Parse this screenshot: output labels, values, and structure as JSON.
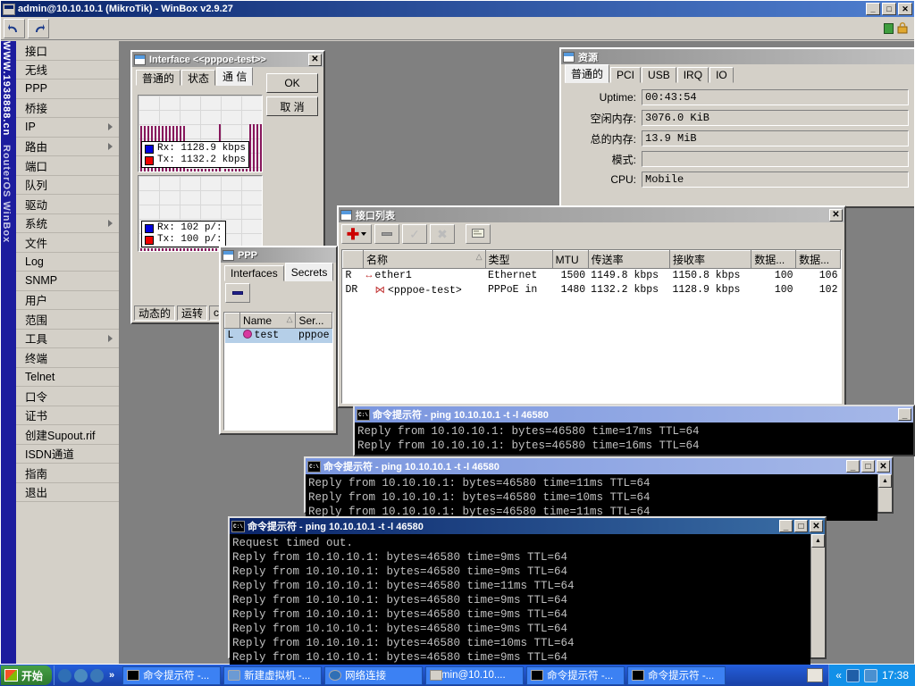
{
  "window": {
    "title": "admin@10.10.10.1 (MikroTik) - WinBox v2.9.27",
    "minimize": "_",
    "restore": "□",
    "close": "✕"
  },
  "toolbar": {
    "undo_icon": "undo-arrow-icon",
    "redo_icon": "redo-arrow-icon",
    "status_icon": "green-bars-icon",
    "lock_icon": "padlock-icon"
  },
  "banner": {
    "url": "WWW.1938888.cn",
    "product": "RouterOS WinBox"
  },
  "menu": {
    "items": [
      {
        "label": "接口",
        "submenu": false
      },
      {
        "label": "无线",
        "submenu": false
      },
      {
        "label": "PPP",
        "submenu": false
      },
      {
        "label": "桥接",
        "submenu": false
      },
      {
        "label": "IP",
        "submenu": true
      },
      {
        "label": "路由",
        "submenu": true
      },
      {
        "label": "端口",
        "submenu": false
      },
      {
        "label": "队列",
        "submenu": false
      },
      {
        "label": "驱动",
        "submenu": false
      },
      {
        "label": "系统",
        "submenu": true
      },
      {
        "label": "文件",
        "submenu": false
      },
      {
        "label": "Log",
        "submenu": false
      },
      {
        "label": "SNMP",
        "submenu": false
      },
      {
        "label": "用户",
        "submenu": false
      },
      {
        "label": "范围",
        "submenu": false
      },
      {
        "label": "工具",
        "submenu": true
      },
      {
        "label": "终端",
        "submenu": false
      },
      {
        "label": "Telnet",
        "submenu": false
      },
      {
        "label": "口令",
        "submenu": false
      },
      {
        "label": "证书",
        "submenu": false
      },
      {
        "label": "创建Supout.rif",
        "submenu": false
      },
      {
        "label": "ISDN通道",
        "submenu": false
      },
      {
        "label": "指南",
        "submenu": false
      },
      {
        "label": "退出",
        "submenu": false
      }
    ]
  },
  "interface_window": {
    "title": "Interface <<pppoe-test>>",
    "close": "✕",
    "tabs": [
      {
        "label": "普通的",
        "active": false
      },
      {
        "label": "状态",
        "active": false
      },
      {
        "label": "通  信",
        "active": true
      }
    ],
    "ok_label": "OK",
    "cancel_label": "取  消",
    "graph_top": {
      "rx_label": "Rx:",
      "rx_value": "1128.9 kbps",
      "tx_label": "Tx:",
      "tx_value": "1132.2 kbps"
    },
    "graph_bottom": {
      "rx_label": "Rx:",
      "rx_value": "102 p/:",
      "tx_label": "Tx:",
      "tx_value": "100 p/:"
    },
    "status": [
      "动态的",
      "运转",
      "c"
    ]
  },
  "resources_window": {
    "title": "资源",
    "tabs": [
      {
        "label": "普通的",
        "active": true
      },
      {
        "label": "PCI",
        "active": false
      },
      {
        "label": "USB",
        "active": false
      },
      {
        "label": "IRQ",
        "active": false
      },
      {
        "label": "IO",
        "active": false
      }
    ],
    "fields": [
      {
        "label": "Uptime:",
        "value": "00:43:54"
      },
      {
        "label": "空闲内存:",
        "value": "3076.0 KiB"
      },
      {
        "label": "总的内存:",
        "value": "13.9 MiB"
      },
      {
        "label": "模式:",
        "value": ""
      },
      {
        "label": "CPU:",
        "value": "Mobile"
      }
    ]
  },
  "interface_list": {
    "title": "接口列表",
    "close": "✕",
    "toolbar": {
      "add": "+",
      "remove": "–",
      "enable": "✓",
      "disable": "✕",
      "comment": "comment-icon"
    },
    "columns": [
      "",
      "名称",
      "类型",
      "MTU",
      "传送率",
      "接收率",
      "数据...",
      "数据..."
    ],
    "rows": [
      {
        "flags": "R",
        "name": "ether1",
        "type": "Ethernet",
        "mtu": "1500",
        "tx": "1149.8 kbps",
        "rx": "1150.8 kbps",
        "packets_tx": "100",
        "packets_rx": "106"
      },
      {
        "flags": "DR",
        "name": "<pppoe-test>",
        "type": "PPPoE in",
        "mtu": "1480",
        "tx": "1132.2 kbps",
        "rx": "1128.9 kbps",
        "packets_tx": "100",
        "packets_rx": "102"
      }
    ]
  },
  "ppp_window": {
    "title": "PPP",
    "tabs": [
      {
        "label": "Interfaces",
        "active": false
      },
      {
        "label": "Secrets",
        "active": true
      }
    ],
    "toolbar": {
      "remove": "–"
    },
    "columns": [
      "",
      "Name",
      "Ser..."
    ],
    "rows": [
      {
        "flags": "L",
        "name": "test",
        "service": "pppoe"
      }
    ]
  },
  "cmd_windows": [
    {
      "title": "命令提示符 - ping 10.10.10.1 -t -l 46580",
      "active": false,
      "buttons": {
        "minimize": "_"
      },
      "lines": [
        "Reply from 10.10.10.1: bytes=46580 time=17ms TTL=64",
        "Reply from 10.10.10.1: bytes=46580 time=16ms TTL=64"
      ]
    },
    {
      "title": "命令提示符 - ping 10.10.10.1 -t -l 46580",
      "active": false,
      "buttons": {
        "minimize": "_",
        "maximize": "□",
        "close": "✕"
      },
      "lines": [
        "Reply from 10.10.10.1: bytes=46580 time=11ms TTL=64",
        "Reply from 10.10.10.1: bytes=46580 time=10ms TTL=64",
        "Reply from 10.10.10.1: bytes=46580 time=11ms TTL=64"
      ]
    },
    {
      "title": "命令提示符 - ping 10.10.10.1 -t -l 46580",
      "active": true,
      "buttons": {
        "minimize": "_",
        "maximize": "□",
        "close": "✕"
      },
      "lines": [
        "Request timed out.",
        "Reply from 10.10.10.1: bytes=46580 time=9ms TTL=64",
        "Reply from 10.10.10.1: bytes=46580 time=9ms TTL=64",
        "Reply from 10.10.10.1: bytes=46580 time=11ms TTL=64",
        "Reply from 10.10.10.1: bytes=46580 time=9ms TTL=64",
        "Reply from 10.10.10.1: bytes=46580 time=9ms TTL=64",
        "Reply from 10.10.10.1: bytes=46580 time=9ms TTL=64",
        "Reply from 10.10.10.1: bytes=46580 time=10ms TTL=64",
        "Reply from 10.10.10.1: bytes=46580 time=9ms TTL=64"
      ]
    }
  ],
  "taskbar": {
    "start_label": "开始",
    "quick_launch": [
      "ie-icon",
      "outlook-icon",
      "media-icon"
    ],
    "chevron": "»",
    "items": [
      {
        "label": "命令提示符 -...",
        "icon": "cmd-icon"
      },
      {
        "label": "新建虚拟机 -...",
        "icon": "vm-icon"
      },
      {
        "label": "网络连接",
        "icon": "network-icon"
      },
      {
        "label": "admin@10.10....",
        "icon": "winbox-icon"
      },
      {
        "label": "命令提示符 -...",
        "icon": "cmd-icon"
      },
      {
        "label": "命令提示符 -...",
        "icon": "cmd-icon"
      }
    ],
    "tray": {
      "chevron": "«",
      "icons": [
        "network-tray-icon",
        "shield-tray-icon"
      ],
      "clock": "17:38"
    }
  },
  "colors": {
    "banner_blue": "#1c1c9e",
    "rx_blue": "#0000dd",
    "tx_red": "#ee0000",
    "title_blue": "#0a246a",
    "face": "#d4d0c8"
  }
}
